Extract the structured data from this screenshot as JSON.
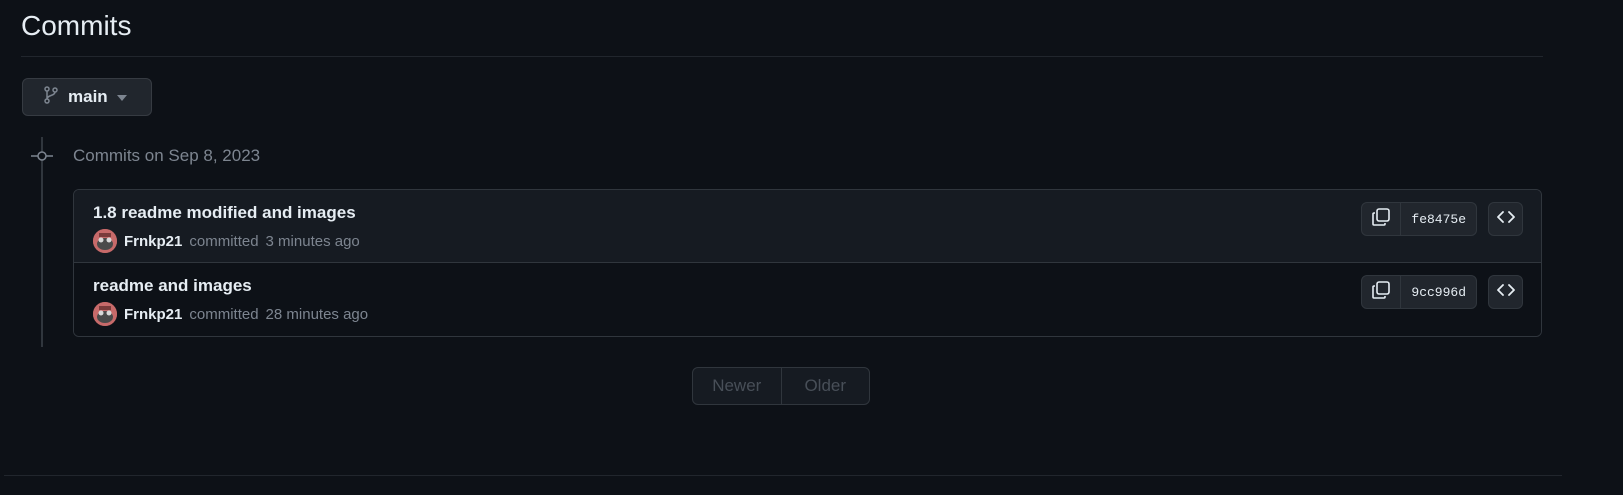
{
  "page": {
    "title": "Commits"
  },
  "branch": {
    "name": "main",
    "icon": "git-branch-icon"
  },
  "group": {
    "heading": "Commits on Sep 8, 2023"
  },
  "commits": [
    {
      "message": "1.8 readme modified and images",
      "author": "Frnkp21",
      "action": "committed",
      "time": "3 minutes ago",
      "sha": "fe8475e"
    },
    {
      "message": "readme and images",
      "author": "Frnkp21",
      "action": "committed",
      "time": "28 minutes ago",
      "sha": "9cc996d"
    }
  ],
  "pagination": {
    "newer_label": "Newer",
    "older_label": "Older"
  },
  "colors": {
    "background": "#0d1117",
    "row_highlight": "#161b22",
    "border": "#30363d",
    "muted_text": "#7d8590",
    "text": "#e6edf3"
  }
}
